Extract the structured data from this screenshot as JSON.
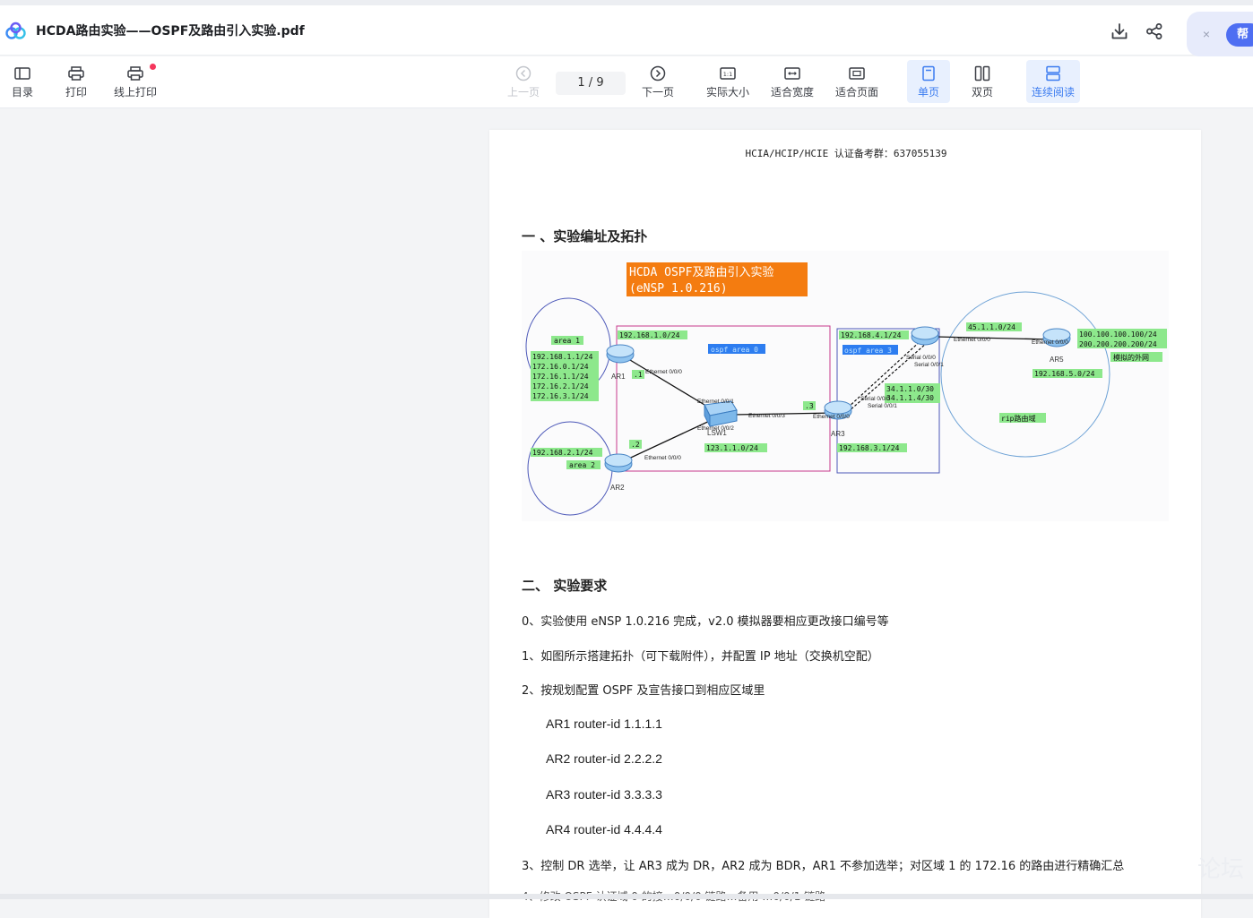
{
  "window": {
    "title": "HCDA路由实验——OSPF及路由引入实验.pdf"
  },
  "header_actions": {
    "download": "download-icon",
    "share": "share-icon"
  },
  "help": {
    "close": "×",
    "label": "帮"
  },
  "toolbar": {
    "toc": "目录",
    "print": "打印",
    "online_print": "线上打印",
    "prev": "上一页",
    "page_indicator": "1 / 9",
    "next": "下一页",
    "actual_size": "实际大小",
    "fit_width": "适合宽度",
    "fit_page": "适合页面",
    "single": "单页",
    "double": "双页",
    "continuous": "连续阅读"
  },
  "document": {
    "page_header": "HCIA/HCIP/HCIE 认证备考群：637055139",
    "section1": "一 、实验编址及拓扑",
    "section2": "二、  实验要求",
    "lines": [
      "0、实验使用 eNSP 1.0.216 完成，v2.0 模拟器要相应更改接口编号等",
      "1、如图所示搭建拓扑（可下载附件），并配置 IP 地址（交换机空配）",
      "2、按规划配置 OSPF 及宣告接口到相应区域里"
    ],
    "router_ids": [
      "AR1 router-id 1.1.1.1",
      "AR2 router-id 2.2.2.2",
      "AR3 router-id 3.3.3.3",
      "AR4 router-id 4.4.4.4"
    ],
    "line3": "3、控制 DR 选举，让 AR3 成为 DR，AR2 成为 BDR，AR1 不参加选举；对区域 1 的 172.16 的路由进行精确汇总",
    "line4_partial": "4、修改 OSPF 认证域 0 的接…0/0/0 链路…备用 …0/0/1 链路"
  },
  "diagram": {
    "title_lines": [
      "HCDA OSPF及路由引入实验",
      "(eNSP 1.0.216)"
    ],
    "area1": "area 1",
    "area1_nets": [
      "192.168.1.1/24",
      "172.16.0.1/24",
      "172.16.1.1/24",
      "172.16.2.1/24",
      "172.16.3.1/24"
    ],
    "area2_net": "192.168.2.1/24",
    "area2": "area 2",
    "area0_net_top": "192.168.1.0/24",
    "area0": "ospf area 0",
    "area0_net_bottom": "123.1.1.0/24",
    "area3_net_top": "192.168.4.1/24",
    "area3": "ospf area 3",
    "area3_net_bottom": "192.168.3.1/24",
    "serial_nets": [
      "34.1.1.0/30",
      "34.1.1.4/30"
    ],
    "rip_link": "45.1.1.0/24",
    "ar5_nets": [
      "100.100.100.100/24",
      "200.200.200.200/24"
    ],
    "external": "模拟的外网",
    "ar5_lan": "192.168.5.0/24",
    "rip": "rip路由域",
    "nodes": [
      "AR1",
      "AR2",
      "AR3",
      "AR5",
      "LSW1"
    ],
    "host_ids": [
      ".1",
      ".2",
      ".3"
    ],
    "ports": {
      "ar1_e": "Ethernet 0/0/0",
      "ar2_e": "Ethernet 0/0/0",
      "sw_e1": "Ethernet 0/0/1",
      "sw_e2": "Ethernet 0/0/2",
      "sw_e3": "Ethernet 0/0/3",
      "ar3_e": "Ethernet 0/0/0",
      "ar3_s0": "Serial 0/0/0",
      "ar3_s1": "Serial 0/0/1",
      "ar4_s0": "Serial 0/0/0",
      "ar4_s1": "Serial 0/0/1",
      "ar4_e": "Ethernet 0/0/0",
      "ar5_e": "Ethernet 0/0/0"
    }
  },
  "watermark": "论坛"
}
